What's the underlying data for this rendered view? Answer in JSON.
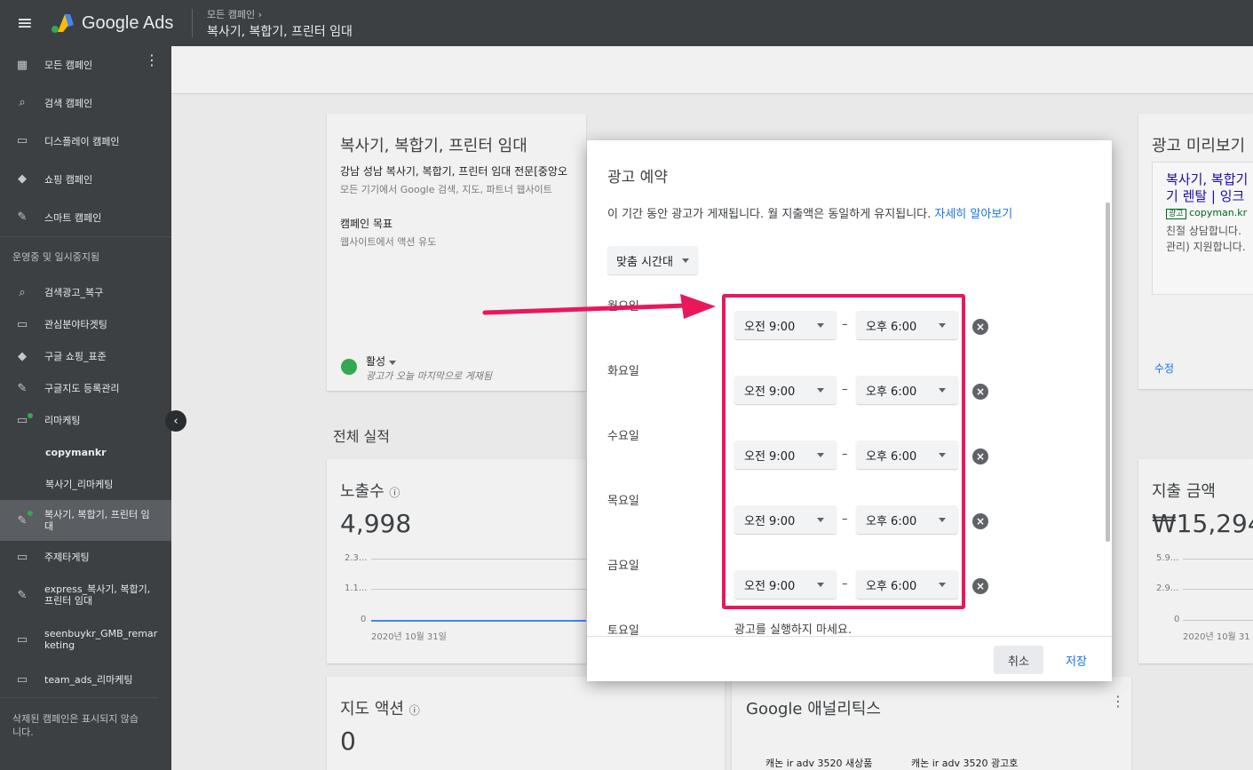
{
  "topbar": {
    "brand": "Google Ads",
    "breadcrumb_parent": "모든 캠페인",
    "breadcrumb_current": "복사기, 복합기, 프린터 임대"
  },
  "sidebar": {
    "items": [
      {
        "label": "모든 캠페인",
        "icon": "grid-icon"
      },
      {
        "label": "검색 캠페인",
        "icon": "search-icon"
      },
      {
        "label": "디스플레이 캠페인",
        "icon": "display-icon"
      },
      {
        "label": "쇼핑 캠페인",
        "icon": "tag-icon"
      },
      {
        "label": "스마트 캠페인",
        "icon": "wand-icon"
      }
    ],
    "section_label": "운영중 및 일시중지됨",
    "campaigns": [
      {
        "label": "검색광고_복구",
        "icon": "search-icon"
      },
      {
        "label": "관심분야타겟팅",
        "icon": "display-icon"
      },
      {
        "label": "구글 쇼핑_표준",
        "icon": "tag-icon"
      },
      {
        "label": "구글지도 등록관리",
        "icon": "wand-icon"
      },
      {
        "label": "리마케팅",
        "icon": "display-icon"
      },
      {
        "label": "copymankr",
        "icon": ""
      },
      {
        "label": "복사기_리마케팅",
        "icon": ""
      },
      {
        "label": "복사기, 복합기, 프린터 임대",
        "icon": "wand-icon"
      },
      {
        "label": "주제타게팅",
        "icon": "display-icon"
      },
      {
        "label": "express_복사기, 복합기, 프린터 임대",
        "icon": "wand-icon"
      },
      {
        "label": "seenbuykr_GMB_remarketing",
        "icon": "display-icon"
      },
      {
        "label": "team_ads_리마케팅",
        "icon": "display-icon"
      }
    ],
    "footer": "삭제된 캠페인은 표시되지 않습니다."
  },
  "background": {
    "campaign_card": {
      "title": "복사기, 복합기, 프린터 임대",
      "subtitle": "강남 성남 복사기, 복합기, 프린터 임대 전문[중앙오",
      "desc": "모든 기기에서 Google 검색, 지도, 파트너 웹사이트",
      "goal_label": "캠페인 목표",
      "goal_value": "웹사이트에서 액션 유도",
      "status": "활성",
      "status_note": "광고가 오늘 마지막으로 게재됨"
    },
    "preview_card": {
      "title": "광고 미리보기",
      "ad_headline": "복사기, 복합기",
      "ad_headline2": "기 렌탈 | 잉크",
      "ad_badge": "광고",
      "ad_url": "copyman.kr",
      "ad_desc1": "친절 상담합니다.",
      "ad_desc2": "관리) 지원합니다.",
      "edit": "수정"
    },
    "performance_title": "전체 실적",
    "impressions": {
      "title": "노출수",
      "value": "4,998",
      "ticks": [
        "2.3...",
        "1.1...",
        "0"
      ],
      "date": "2020년 10월 31일"
    },
    "spend": {
      "title": "지출 금액",
      "value": "₩15,294",
      "ticks": [
        "5.9...",
        "2.9...",
        "0"
      ],
      "date": "2020년 10월 31"
    },
    "map_actions": {
      "title": "지도 액션",
      "value": "0"
    },
    "analytics": {
      "title": "Google 애널리틱스",
      "col1": "캐논 ir adv 3520 새상품",
      "col2": "캐논 ir adv 3520 광고호"
    }
  },
  "dialog": {
    "title": "광고 예약",
    "description": "이 기간 동안 광고가 게재됩니다. 월 지출액은 동일하게 유지됩니다.",
    "learn_more": "자세히 알아보기",
    "preset": "맞춤 시간대",
    "days": [
      {
        "label": "월요일",
        "start": "오전 9:00",
        "end": "오후 6:00"
      },
      {
        "label": "화요일",
        "start": "오전 9:00",
        "end": "오후 6:00"
      },
      {
        "label": "수요일",
        "start": "오전 9:00",
        "end": "오후 6:00"
      },
      {
        "label": "목요일",
        "start": "오전 9:00",
        "end": "오후 6:00"
      },
      {
        "label": "금요일",
        "start": "오전 9:00",
        "end": "오후 6:00"
      }
    ],
    "saturday_label": "토요일",
    "saturday_value": "광고를 실행하지 마세요.",
    "dash": "–",
    "cancel": "취소",
    "save": "저장"
  },
  "colors": {
    "topbar": "#3c4043",
    "accent_blue": "#1a73e8",
    "highlight": "#e8185b",
    "status_green": "#34a853"
  }
}
